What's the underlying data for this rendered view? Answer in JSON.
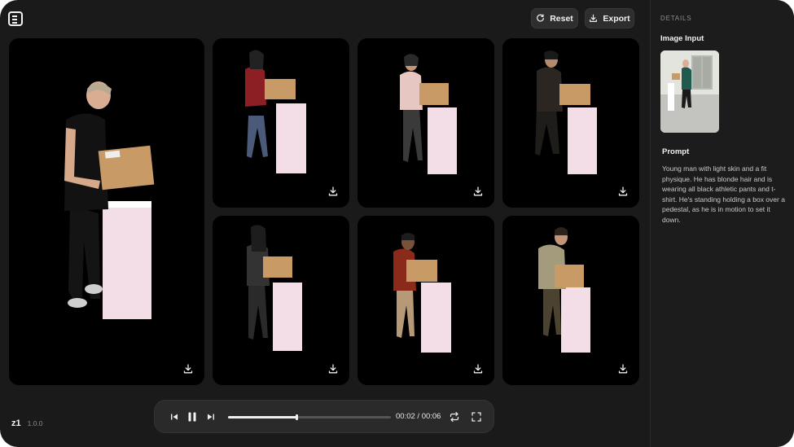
{
  "toolbar": {
    "reset_label": "Reset",
    "export_label": "Export"
  },
  "tiles": [
    {
      "name": "main-preview",
      "figure": "young man black shirt"
    },
    {
      "name": "variant-1",
      "figure": "woman red sweater"
    },
    {
      "name": "variant-2",
      "figure": "woman pink blouse"
    },
    {
      "name": "variant-3",
      "figure": "woman dark outfit"
    },
    {
      "name": "variant-4",
      "figure": "woman dark jacket"
    },
    {
      "name": "variant-5",
      "figure": "man red shirt"
    },
    {
      "name": "variant-6",
      "figure": "man olive shirt"
    }
  ],
  "sidebar": {
    "section_title": "DETAILS",
    "image_input_label": "Image Input",
    "prompt_label": "Prompt",
    "prompt_text": "Young man with light skin and a fit physique. He has blonde hair and is wearing all black athletic pants and t-shirt. He's standing holding a box over a pedestal, as he is in motion to set it down."
  },
  "brand": {
    "mark": "z1",
    "version": "1.0.0"
  },
  "player": {
    "time": "00:02 / 00:06",
    "progress": 0.42
  },
  "colors": {
    "background": "#1a1a1a",
    "tile": "#000000",
    "pedestal": "#f3dde6",
    "box": "#c89a66"
  },
  "icons": [
    "logo-icon",
    "reset-icon",
    "export-icon",
    "download-icon",
    "skip-back-icon",
    "pause-icon",
    "skip-forward-icon",
    "loop-icon",
    "fullscreen-icon"
  ]
}
